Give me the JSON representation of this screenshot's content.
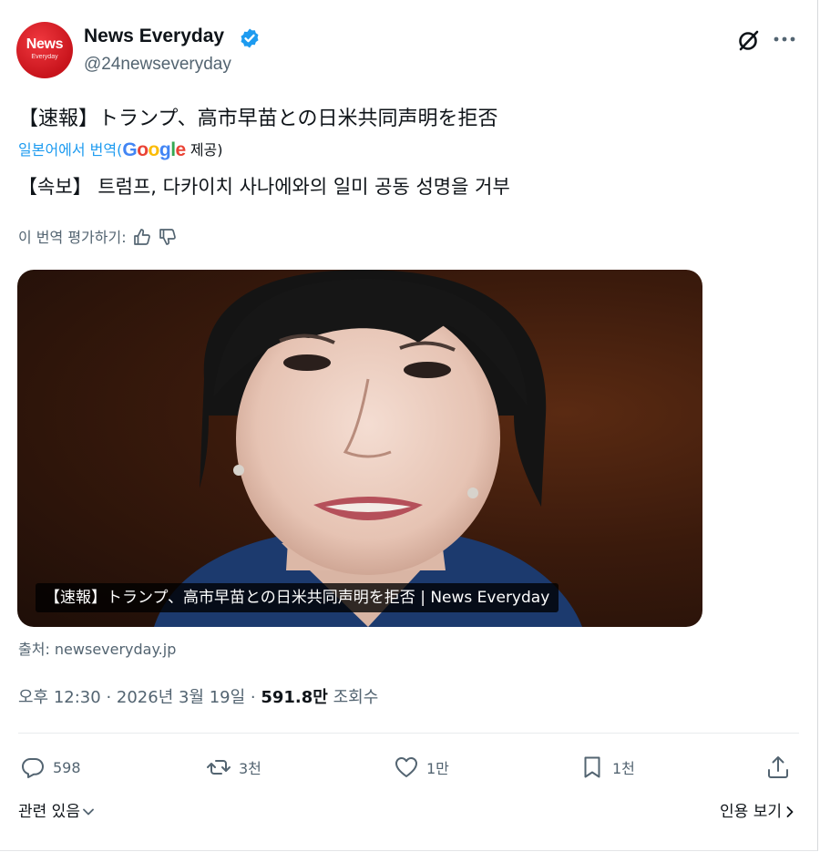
{
  "account": {
    "avatar_text": "News",
    "avatar_subtext": "Everyday",
    "name": "News Everyday",
    "handle": "@24newseveryday",
    "verified_icon": "verified-badge-icon",
    "brand_color": "#d7191f"
  },
  "header_actions": {
    "grok_icon": "grok-icon",
    "more_icon": "more-icon"
  },
  "post": {
    "original_text": "【速報】トランプ、高市早苗との日米共同声明を拒否",
    "translated_from": "일본어에서 번역(",
    "translator": "Google",
    "provided": " 제공)",
    "translated_text": "【속보】 트럼프, 다카이치 사나에와의 일미 공동 성명을 거부",
    "rate_label": "이 번역 평가하기:",
    "rate_up_icon": "thumbs-up-icon",
    "rate_down_icon": "thumbs-down-icon"
  },
  "media": {
    "caption": "【速報】トランプ、高市早苗との日米共同声明を拒否 | News Everyday",
    "source": "출처: newseveryday.jp"
  },
  "meta": {
    "time": "오후 12:30",
    "separator": " · ",
    "date": "2026년 3월 19일",
    "views": "591.8만",
    "views_label": " 조회수"
  },
  "actions": {
    "replies": "598",
    "reposts": "3천",
    "likes": "1만",
    "bookmarks": "1천"
  },
  "footer": {
    "related": "관련 있음",
    "quotes": "인용 보기"
  },
  "colors": {
    "accent": "#1d9bf0",
    "secondary_text": "#536471",
    "primary_text": "#0f1419"
  }
}
